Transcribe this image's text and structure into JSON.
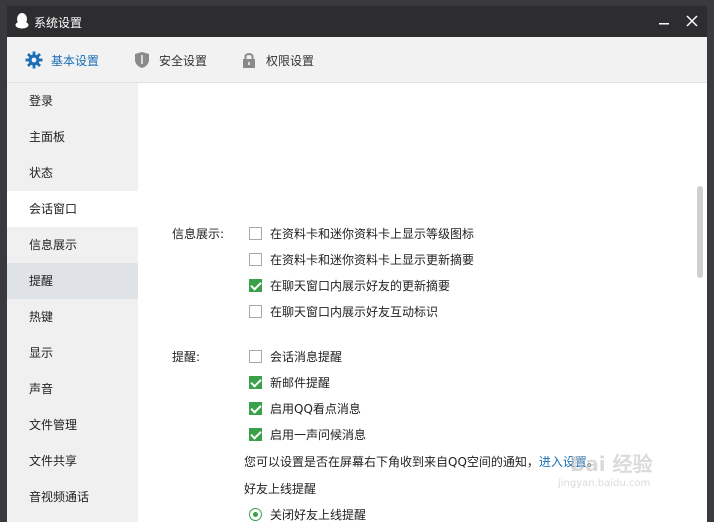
{
  "window": {
    "title": "系统设置"
  },
  "tabs": [
    {
      "label": "基本设置",
      "icon": "gear-icon",
      "active": true
    },
    {
      "label": "安全设置",
      "icon": "shield-icon",
      "active": false
    },
    {
      "label": "权限设置",
      "icon": "lock-icon",
      "active": false
    }
  ],
  "sidebar": {
    "items": [
      {
        "label": "登录"
      },
      {
        "label": "主面板"
      },
      {
        "label": "状态"
      },
      {
        "label": "会话窗口",
        "selected": true
      },
      {
        "label": "信息展示"
      },
      {
        "label": "提醒",
        "hover": true
      },
      {
        "label": "热键"
      },
      {
        "label": "显示"
      },
      {
        "label": "声音"
      },
      {
        "label": "文件管理"
      },
      {
        "label": "文件共享"
      },
      {
        "label": "音视频通话"
      }
    ]
  },
  "info_section": {
    "label": "信息展示:",
    "options": [
      {
        "label": "在资料卡和迷你资料卡上显示等级图标",
        "checked": false
      },
      {
        "label": "在资料卡和迷你资料卡上显示更新摘要",
        "checked": false
      },
      {
        "label": "在聊天窗口内展示好友的更新摘要",
        "checked": true
      },
      {
        "label": "在聊天窗口内展示好友互动标识",
        "checked": false
      }
    ]
  },
  "reminder_section": {
    "label": "提醒:",
    "options": [
      {
        "label": "会话消息提醒",
        "checked": false
      },
      {
        "label": "新邮件提醒",
        "checked": true
      },
      {
        "label": "启用QQ看点消息",
        "checked": true
      },
      {
        "label": "启用一声问候消息",
        "checked": true
      }
    ],
    "notice_text": "您可以设置是否在屏幕右下角收到来自QQ空间的通知，",
    "notice_link": "进入设置",
    "notice_end": "。",
    "online_heading": "好友上线提醒",
    "online_option": "关闭好友上线提醒"
  },
  "watermark": {
    "main": "Bai 经验",
    "sub": "jingyan.baidu.com"
  },
  "colors": {
    "accent": "#1a6fb5",
    "check": "#3aa04a",
    "titlebar": "#2d2d30"
  }
}
